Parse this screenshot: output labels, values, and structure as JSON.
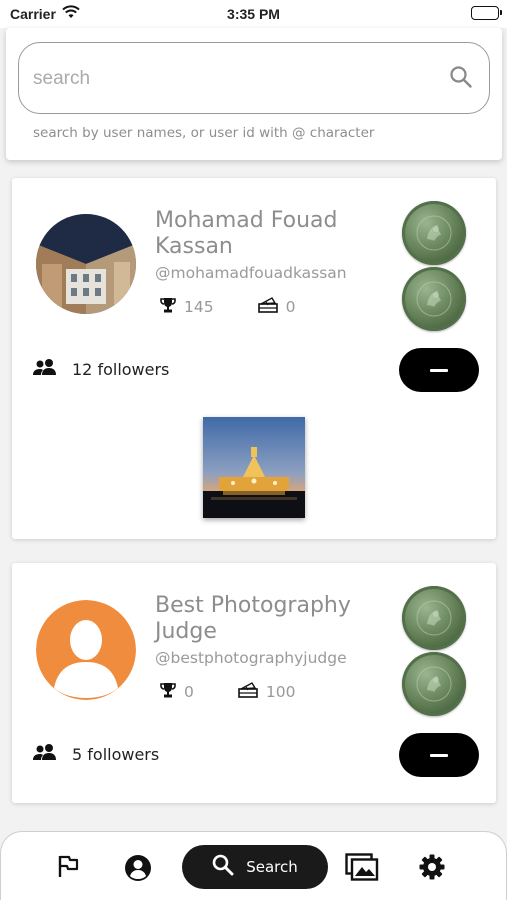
{
  "status_bar": {
    "carrier": "Carrier",
    "time": "3:35 PM"
  },
  "search": {
    "placeholder": "search",
    "value": "",
    "hint": "search by user names, or user id with @ character"
  },
  "results": [
    {
      "name": "Mohamad Fouad Kassan",
      "handle": "@mohamadfouadkassan",
      "trophies": "145",
      "tickets": "0",
      "followers": "12 followers",
      "badges": [
        "medal-coin-icon",
        "medal-coin-icon"
      ],
      "has_post_thumbnail": true
    },
    {
      "name": "Best Photography Judge",
      "handle": "@bestphotographyjudge",
      "trophies": "0",
      "tickets": "100",
      "followers": "5 followers",
      "badges": [
        "medal-coin-icon",
        "medal-coin-icon"
      ],
      "has_post_thumbnail": false
    }
  ],
  "bottom_nav": {
    "items": [
      "flag-icon",
      "account-icon",
      "search-icon",
      "gallery-icon",
      "settings-icon"
    ],
    "active_label": "Search"
  },
  "colors": {
    "accent": "#000000",
    "default_avatar": "#f08c3e",
    "coin": "#6e8b62"
  }
}
